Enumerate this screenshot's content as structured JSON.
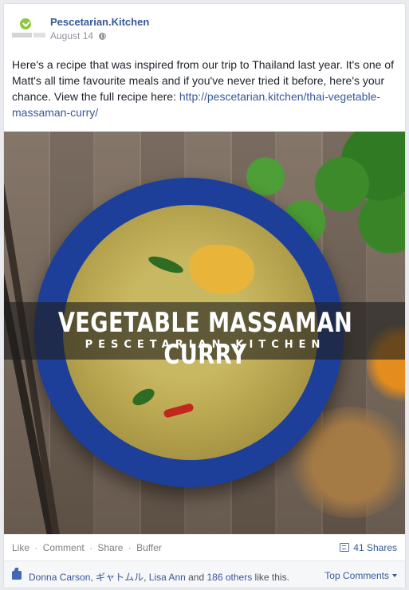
{
  "post": {
    "page_name": "Pescetarian.Kitchen",
    "date": "August 14",
    "text_prefix": "Here's a recipe that was inspired from our trip to Thailand last year. It's one of Matt's all time favourite meals and if you've never tried it before, here's your chance. View the full recipe here: ",
    "link": "http://pescetarian.kitchen/thai-vegetable-massaman-curry/"
  },
  "photo": {
    "title": "VEGETABLE MASSAMAN CURRY",
    "subtitle": "PESCETARIAN.KITCHEN"
  },
  "actions": {
    "like": "Like",
    "comment": "Comment",
    "share": "Share",
    "buffer": "Buffer",
    "sep": "·",
    "shares_count": "41 Shares"
  },
  "likes": {
    "name1": "Donna Carson",
    "name2": "ギャトムル",
    "name3": "Lisa Ann",
    "and": " and ",
    "others": "186 others",
    "suffix": " like this.",
    "top_comments": "Top Comments"
  },
  "colors": {
    "link": "#365899",
    "bowl": "#1d3f9a",
    "brand_green": "#8dc63f"
  }
}
